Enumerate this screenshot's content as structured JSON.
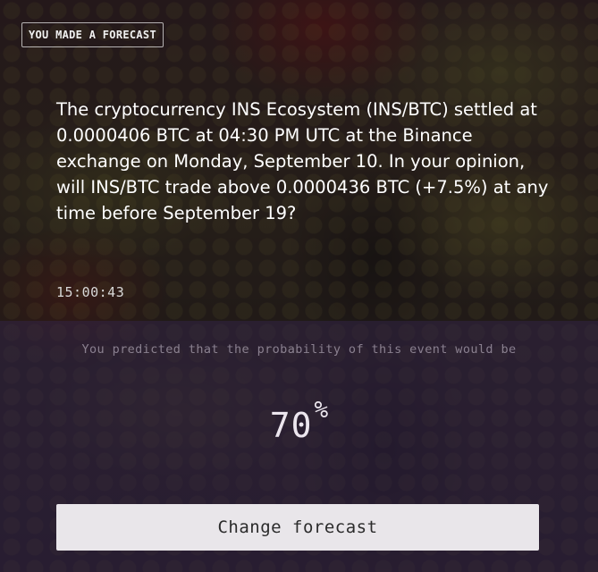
{
  "badge": {
    "label": "YOU MADE A FORECAST"
  },
  "question": {
    "text": "The cryptocurrency INS Ecosystem (INS/BTC) settled at 0.0000406 BTC at 04:30 PM UTC at the Binance exchange on Monday, September 10. In your opinion, will INS/BTC trade above 0.0000436 BTC (+7.5%) at any time before September 19?"
  },
  "timer": {
    "value": "15:00:43"
  },
  "prediction": {
    "intro": "You predicted that the probability of this event would be",
    "value": "70",
    "unit": "%"
  },
  "actions": {
    "change_label": "Change forecast"
  },
  "colors": {
    "button_bg": "#e9e6ea",
    "overlay_bottom": "#281c34"
  }
}
